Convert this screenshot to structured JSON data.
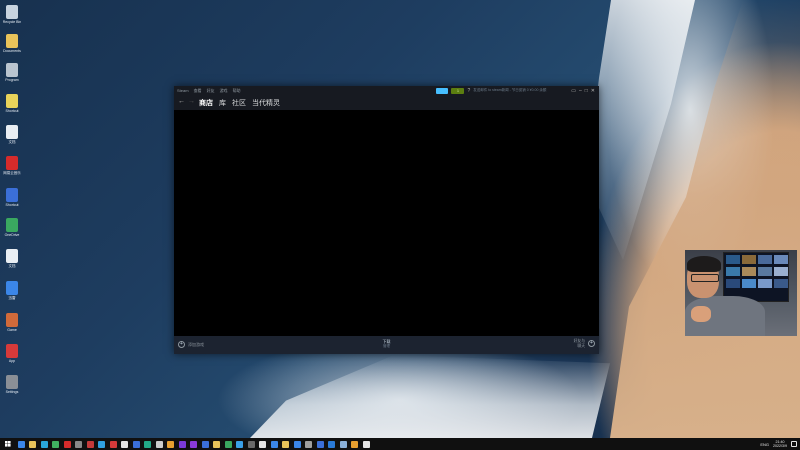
{
  "desktop": {
    "icons": [
      {
        "label": "Recycle Bin",
        "color": "#c7d3df"
      },
      {
        "label": "Documents",
        "color": "#e8c35a"
      },
      {
        "label": "Program",
        "color": "#b9c4cf"
      },
      {
        "label": "Shortcut",
        "color": "#e8d35a"
      },
      {
        "label": "文档",
        "color": "#e9eef3"
      },
      {
        "label": "网易云音乐",
        "color": "#d62b2b"
      },
      {
        "label": "Shortcut",
        "color": "#3b6fd8"
      },
      {
        "label": "OneDrive",
        "color": "#3aa860"
      },
      {
        "label": "文档",
        "color": "#e9eef3"
      },
      {
        "label": "迅雷",
        "color": "#3b86e8"
      },
      {
        "label": "Game",
        "color": "#d06a3a"
      },
      {
        "label": "App",
        "color": "#d63a3a"
      },
      {
        "label": "Settings",
        "color": "#8a8f96"
      }
    ]
  },
  "steam": {
    "menu": [
      "Steam",
      "查看",
      "好友",
      "游戏",
      "帮助"
    ],
    "green_button_label": "1",
    "user_text": "发送邮件 to steam新闻 - 节日促销 0 ¥0.00 余额",
    "window_controls": [
      "▭",
      "–",
      "□",
      "✕"
    ],
    "nav": {
      "back": "←",
      "forward": "→",
      "tabs": [
        "商店",
        "库",
        "社区",
        "当代精灵"
      ],
      "active_tab": 0
    },
    "bottom": {
      "add_game": "添加游戏",
      "downloads_title": "下载",
      "downloads_sub": "管理",
      "friends_line1": "好友与",
      "friends_line2": "聊天"
    },
    "colors": {
      "store_button": "#47bfff",
      "green_button": "#5c7e10",
      "titlebar": "#171a21",
      "bottombar": "#1c2330"
    }
  },
  "taskbar": {
    "apps": [
      "#3b86e8",
      "#e8c35a",
      "#2aa6d8",
      "#40b060",
      "#d62b2b",
      "#888888",
      "#c43a3a",
      "#30a0e0",
      "#d63a3a",
      "#e5e5e5",
      "#3b6fd8",
      "#22aa88",
      "#cccccc",
      "#e8a030",
      "#7a3ad8",
      "#8a3ad8",
      "#3b6fd8",
      "#e8c35a",
      "#3aa860",
      "#3aa0e8",
      "#6a6a6a",
      "#e5e5e5",
      "#3b86e8",
      "#e8c35a",
      "#3b86e8",
      "#a0a0a0",
      "#3b6fd8",
      "#2a7ad8",
      "#8ab0d8",
      "#e8a030",
      "#e5e5e5"
    ],
    "ime": "ENG",
    "time": "21:40",
    "date": "2022/3/9"
  }
}
